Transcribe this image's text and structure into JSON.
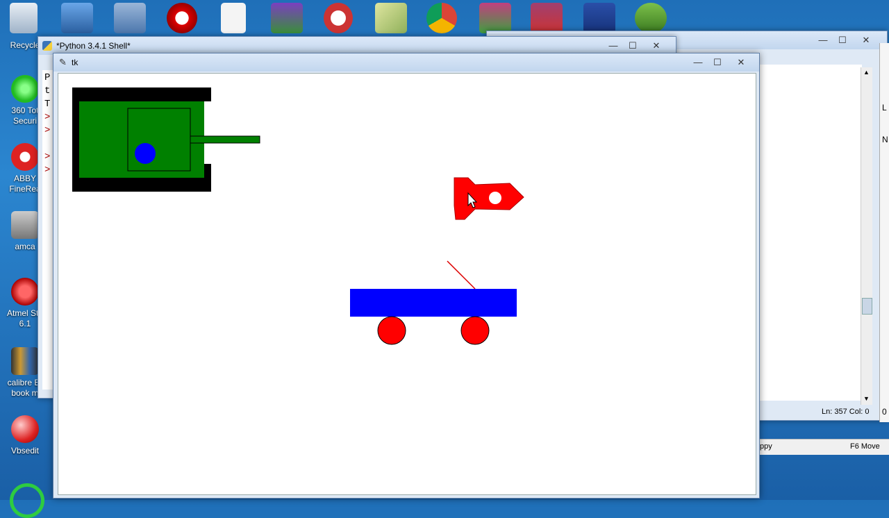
{
  "desktop": {
    "icons": [
      {
        "label": "Recycle",
        "icon": "recycle-bin-icon"
      },
      {
        "label": "360 Tot Securi",
        "icon": "360-security-icon"
      },
      {
        "label": "ABBY FineRea",
        "icon": "abbyy-icon"
      },
      {
        "label": "amca",
        "icon": "amca-icon"
      },
      {
        "label": "Atmel Stu 6.1",
        "icon": "atmel-studio-icon"
      },
      {
        "label": "calibre E-book m",
        "icon": "calibre-icon"
      },
      {
        "label": "Vbsedit",
        "icon": "vbsedit-icon"
      }
    ]
  },
  "shell_window": {
    "title": "*Python 3.4.1 Shell*",
    "text_lines": [
      "P",
      "t",
      "T",
      ">",
      ">",
      ">",
      ">"
    ],
    "min": "—",
    "max": "☐",
    "close": "✕"
  },
  "right_window": {
    "min": "—",
    "max": "☐",
    "close": "✕",
    "status": "Ln: 357 Col: 0",
    "side_letters": [
      "L",
      "N"
    ],
    "bottom_left": "ppy",
    "bottom_right": "F6 Move",
    "bottom_zero": "0"
  },
  "tk_window": {
    "title": "tk",
    "min": "—",
    "max": "☐",
    "close": "✕"
  },
  "colors": {
    "tank_body": "#008000",
    "tank_tracks": "#000000",
    "turret_dot": "#0000ff",
    "rocket": "#ff0000",
    "cart_body": "#0000ff",
    "wheels": "#ff0000"
  }
}
